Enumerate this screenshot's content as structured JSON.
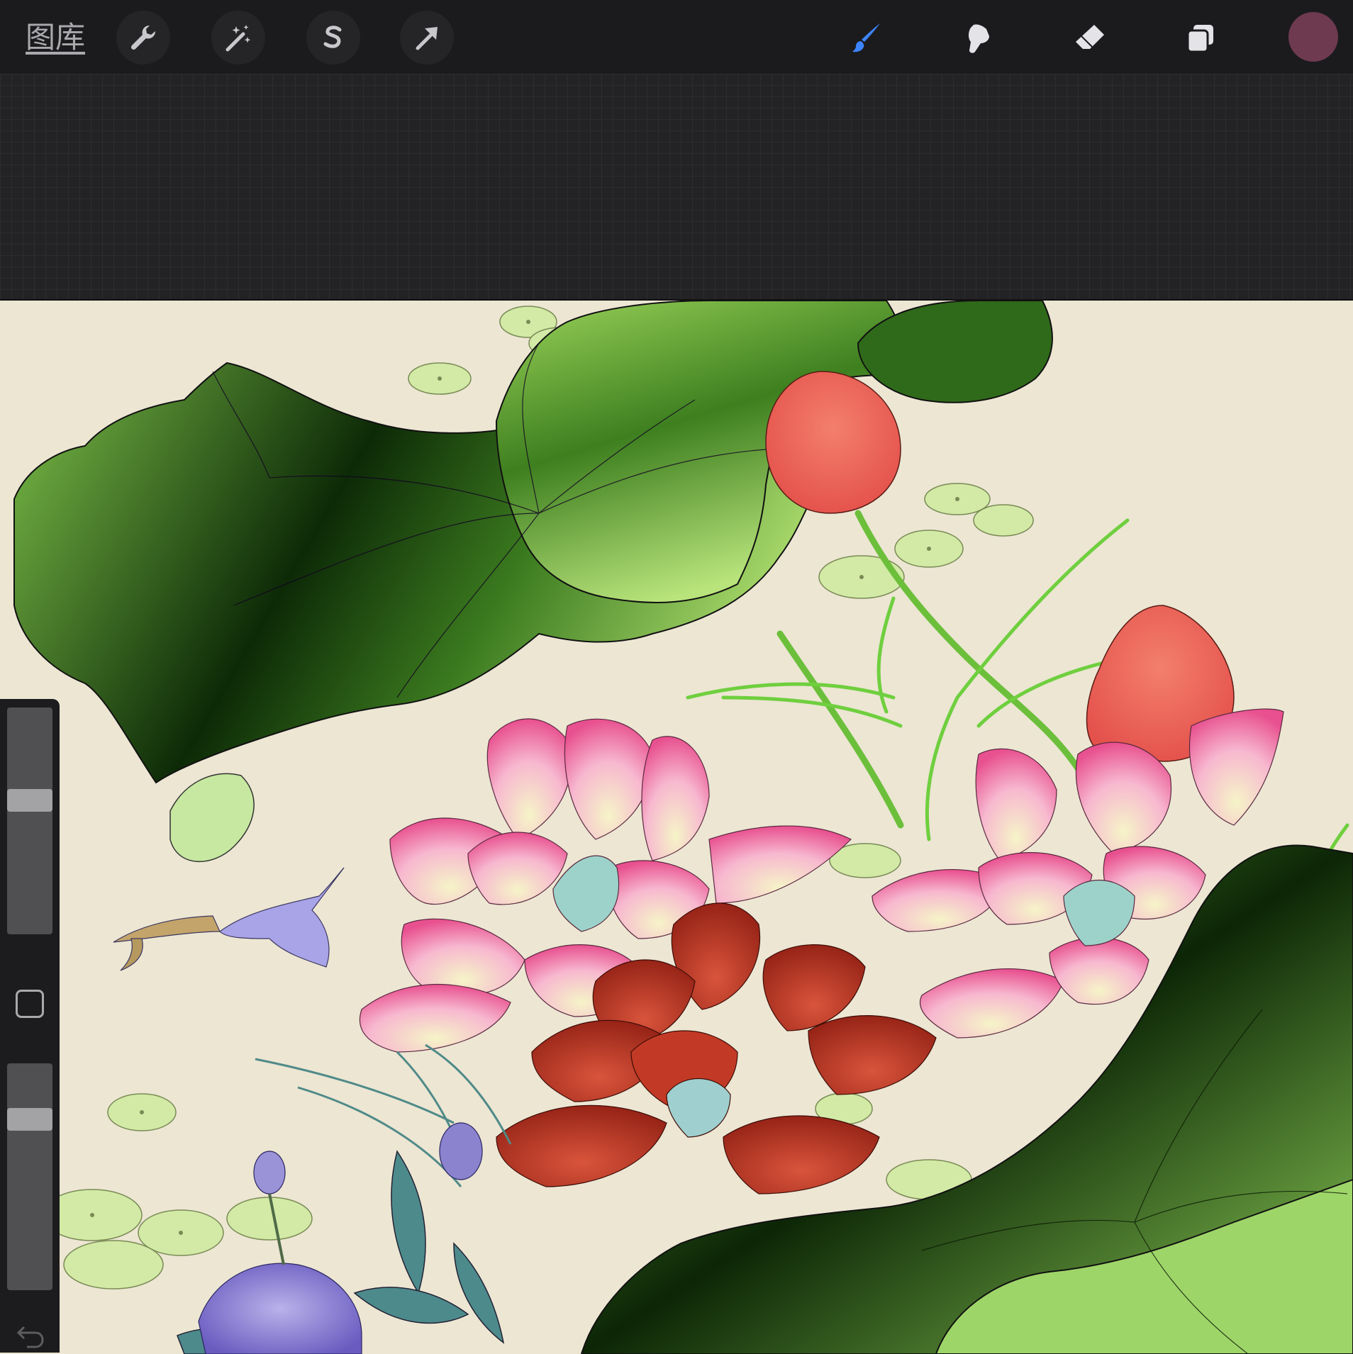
{
  "toolbar": {
    "gallery_label": "图库",
    "tools": [
      {
        "name": "actions",
        "icon": "wrench-icon"
      },
      {
        "name": "adjustments",
        "icon": "magic-wand-icon"
      },
      {
        "name": "selection",
        "icon": "selection-s-icon"
      },
      {
        "name": "transform",
        "icon": "arrow-cursor-icon"
      },
      {
        "name": "brush",
        "icon": "brush-icon",
        "active": true
      },
      {
        "name": "smudge",
        "icon": "smudge-finger-icon"
      },
      {
        "name": "eraser",
        "icon": "eraser-icon"
      },
      {
        "name": "layers",
        "icon": "layers-icon"
      }
    ],
    "current_color": "#6e3a4f",
    "active_tool_color": "#3d84ff"
  },
  "sidebar": {
    "brush_size_level": 0.6,
    "opacity_level": 0.78,
    "modifier_icon": "square-modifier-icon",
    "undo_icon": "undo-icon"
  },
  "canvas": {
    "paper_color": "#ece6d3",
    "subject": "lotus-painting"
  }
}
